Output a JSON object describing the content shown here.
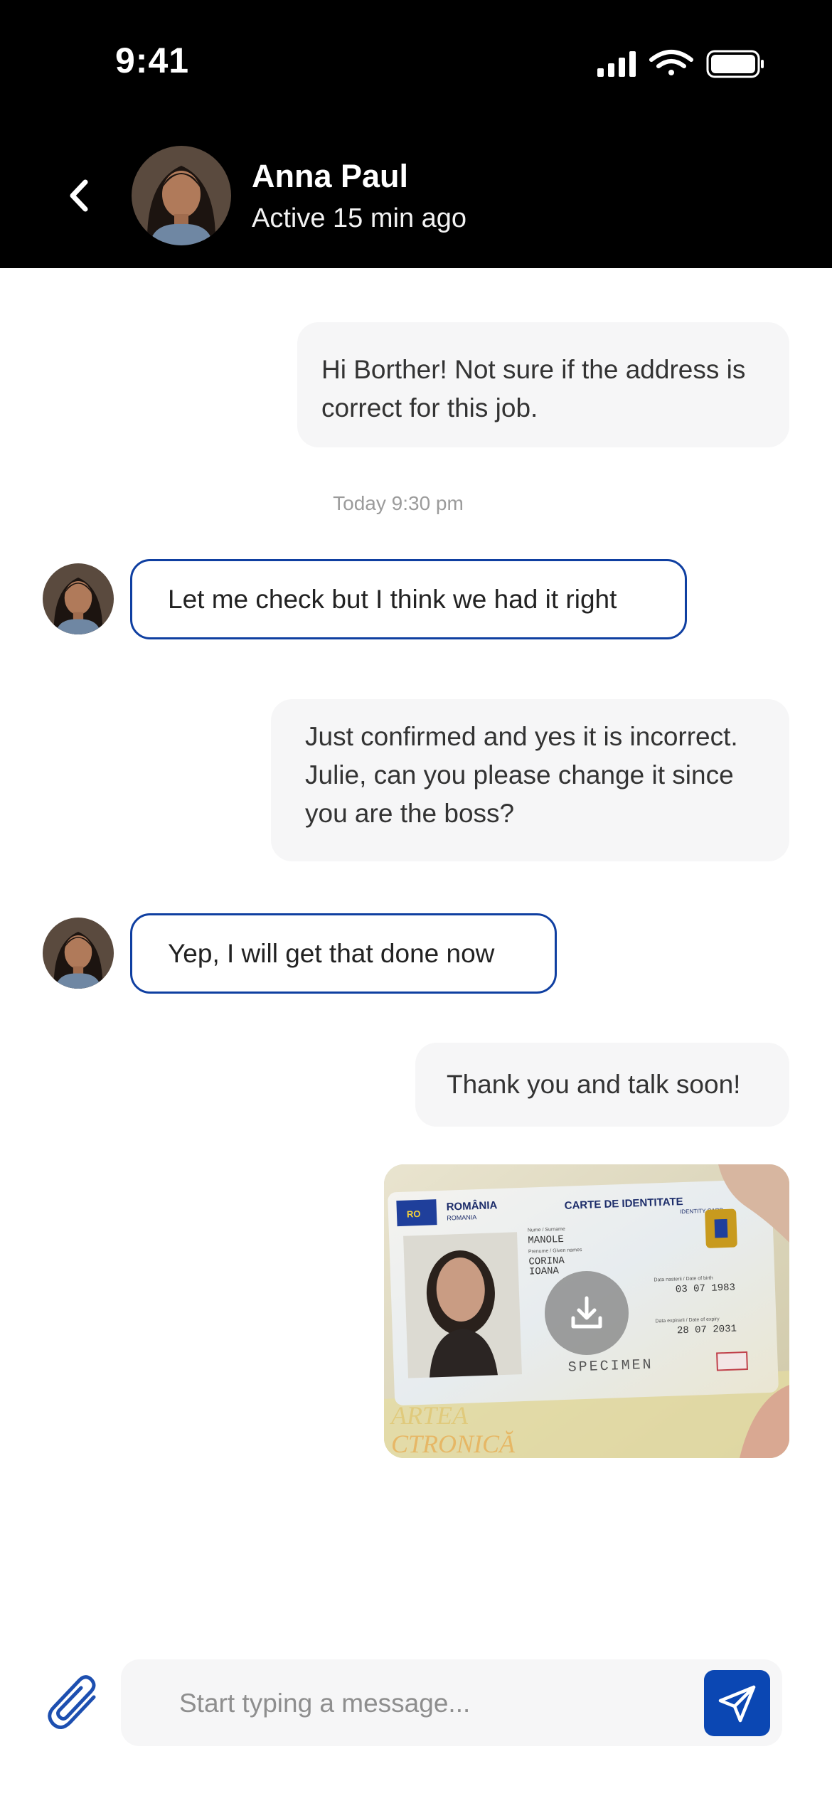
{
  "status_bar": {
    "time": "9:41"
  },
  "header": {
    "name": "Anna Paul",
    "status": "Active 15 min ago",
    "back_icon": "chevron-left-icon"
  },
  "messages": [
    {
      "direction": "outgoing",
      "text_lines": [
        "Hi Borther! Not sure if the address is",
        "correct for this job."
      ]
    },
    {
      "direction": "incoming",
      "text": "Let me check but I think we had it right"
    },
    {
      "direction": "outgoing",
      "text_lines": [
        "Just confirmed and yes it is incorrect.",
        "Julie, can you please change it since",
        "you are the boss?"
      ]
    },
    {
      "direction": "incoming",
      "text": "Yep, I will get that done now"
    },
    {
      "direction": "outgoing",
      "text": "Thank you and talk soon!"
    }
  ],
  "timestamp": "Today 9:30 pm",
  "attachment": {
    "type": "image",
    "id_card": {
      "country": "ROMÂNIA",
      "country_sub": "ROMANIA",
      "title": "CARTE DE IDENTITATE",
      "title_sub": "IDENTITY CARD",
      "ro_badge": "RO",
      "surname_label": "Nume / Surname",
      "surname": "MANOLE",
      "given_label": "Prenume / Given names",
      "given_1": "CORINA",
      "given_2": "IOANA",
      "birth_label": "Data nasterii / Date of birth",
      "birth_date": "03 07 1983",
      "expiry_label": "Data expirarii / Date of expiry",
      "expiry_date": "28 07 2031",
      "specimen": "SPECIMEN",
      "footer_1": "ARTEA",
      "footer_2": "CTRONICĂ"
    },
    "download_icon": "download-icon"
  },
  "composer": {
    "placeholder": "Start typing a message...",
    "attach_icon": "paperclip-icon",
    "send_icon": "send-icon"
  },
  "colors": {
    "header_bg": "#000000",
    "accent": "#0b47b3",
    "incoming_border": "#0f3fa1",
    "outgoing_bg": "#f6f6f7"
  }
}
